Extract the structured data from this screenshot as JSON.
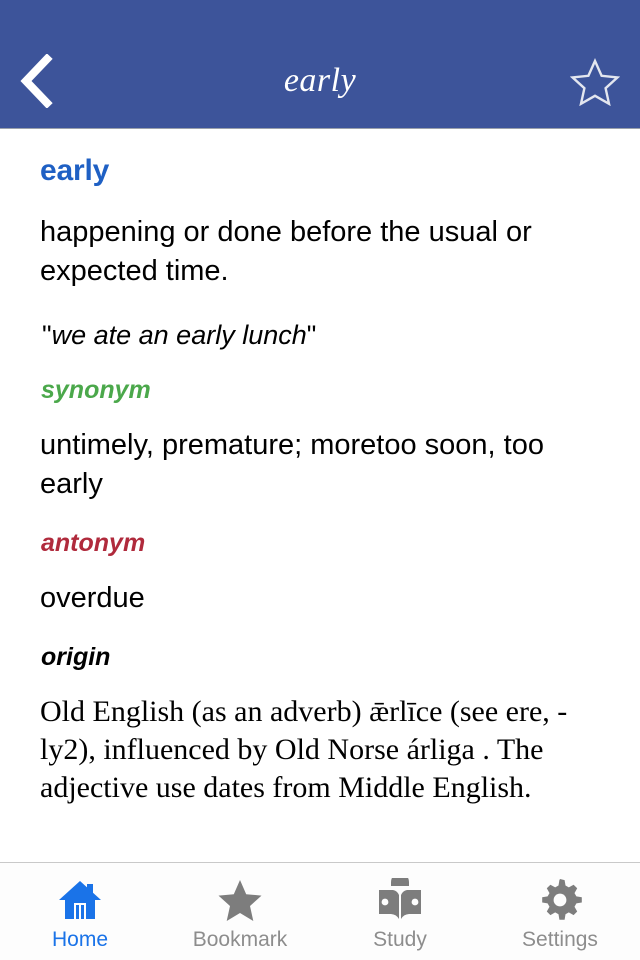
{
  "header": {
    "title": "early",
    "back_icon": "chevron-left-icon",
    "favorite_icon": "star-outline-icon",
    "background_color": "#3d549a",
    "title_color": "#ffffff"
  },
  "entry": {
    "headword": "early",
    "headword_color": "#1f60c4",
    "definition": "happening or done before the usual or expected time.",
    "example": "we ate an early lunch",
    "quote_mark": "\"",
    "sections": [
      {
        "label": "synonym",
        "label_color": "#4ba84b",
        "body": "untimely, premature; moretoo soon, too early"
      },
      {
        "label": "antonym",
        "label_color": "#b02a3c",
        "body": "overdue"
      },
      {
        "label": "origin",
        "label_color": "#000000",
        "body": "Old English (as an adverb) ǣrlīce (see ere, -ly2), influenced by Old Norse árliga . The adjective use dates from Middle English."
      }
    ]
  },
  "tabbar": {
    "active_color": "#1a73e8",
    "inactive_color": "#8d8d8d",
    "items": [
      {
        "label": "Home",
        "icon": "home-icon",
        "active": true
      },
      {
        "label": "Bookmark",
        "icon": "star-filled-icon",
        "active": false
      },
      {
        "label": "Study",
        "icon": "person-reading-book-icon",
        "active": false
      },
      {
        "label": "Settings",
        "icon": "gear-icon",
        "active": false
      }
    ]
  }
}
